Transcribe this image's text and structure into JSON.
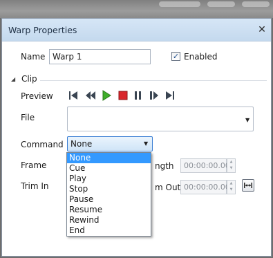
{
  "window": {
    "title": "Warp Properties"
  },
  "name_field": {
    "label": "Name",
    "value": "Warp 1"
  },
  "enabled": {
    "label": "Enabled",
    "checked": true
  },
  "clip_section": {
    "label": "Clip"
  },
  "preview": {
    "label": "Preview",
    "buttons": [
      "skip-first-icon",
      "rewind-icon",
      "play-icon",
      "stop-icon",
      "pause-icon",
      "step-forward-icon",
      "skip-last-icon"
    ]
  },
  "file": {
    "label": "File",
    "value": ""
  },
  "command": {
    "label": "Command",
    "selected": "None",
    "options": [
      "None",
      "Cue",
      "Play",
      "Stop",
      "Pause",
      "Resume",
      "Rewind",
      "End"
    ]
  },
  "frame": {
    "label": "Frame"
  },
  "length": {
    "label_partial": "ngth",
    "value": "00:00:00.00"
  },
  "trim_in": {
    "label": "Trim In"
  },
  "trim_out": {
    "label_partial": "m Out",
    "value": "00:00:00.00"
  },
  "colors": {
    "accent": "#3399ff",
    "play": "#3fae2a",
    "stop": "#d9262c"
  }
}
